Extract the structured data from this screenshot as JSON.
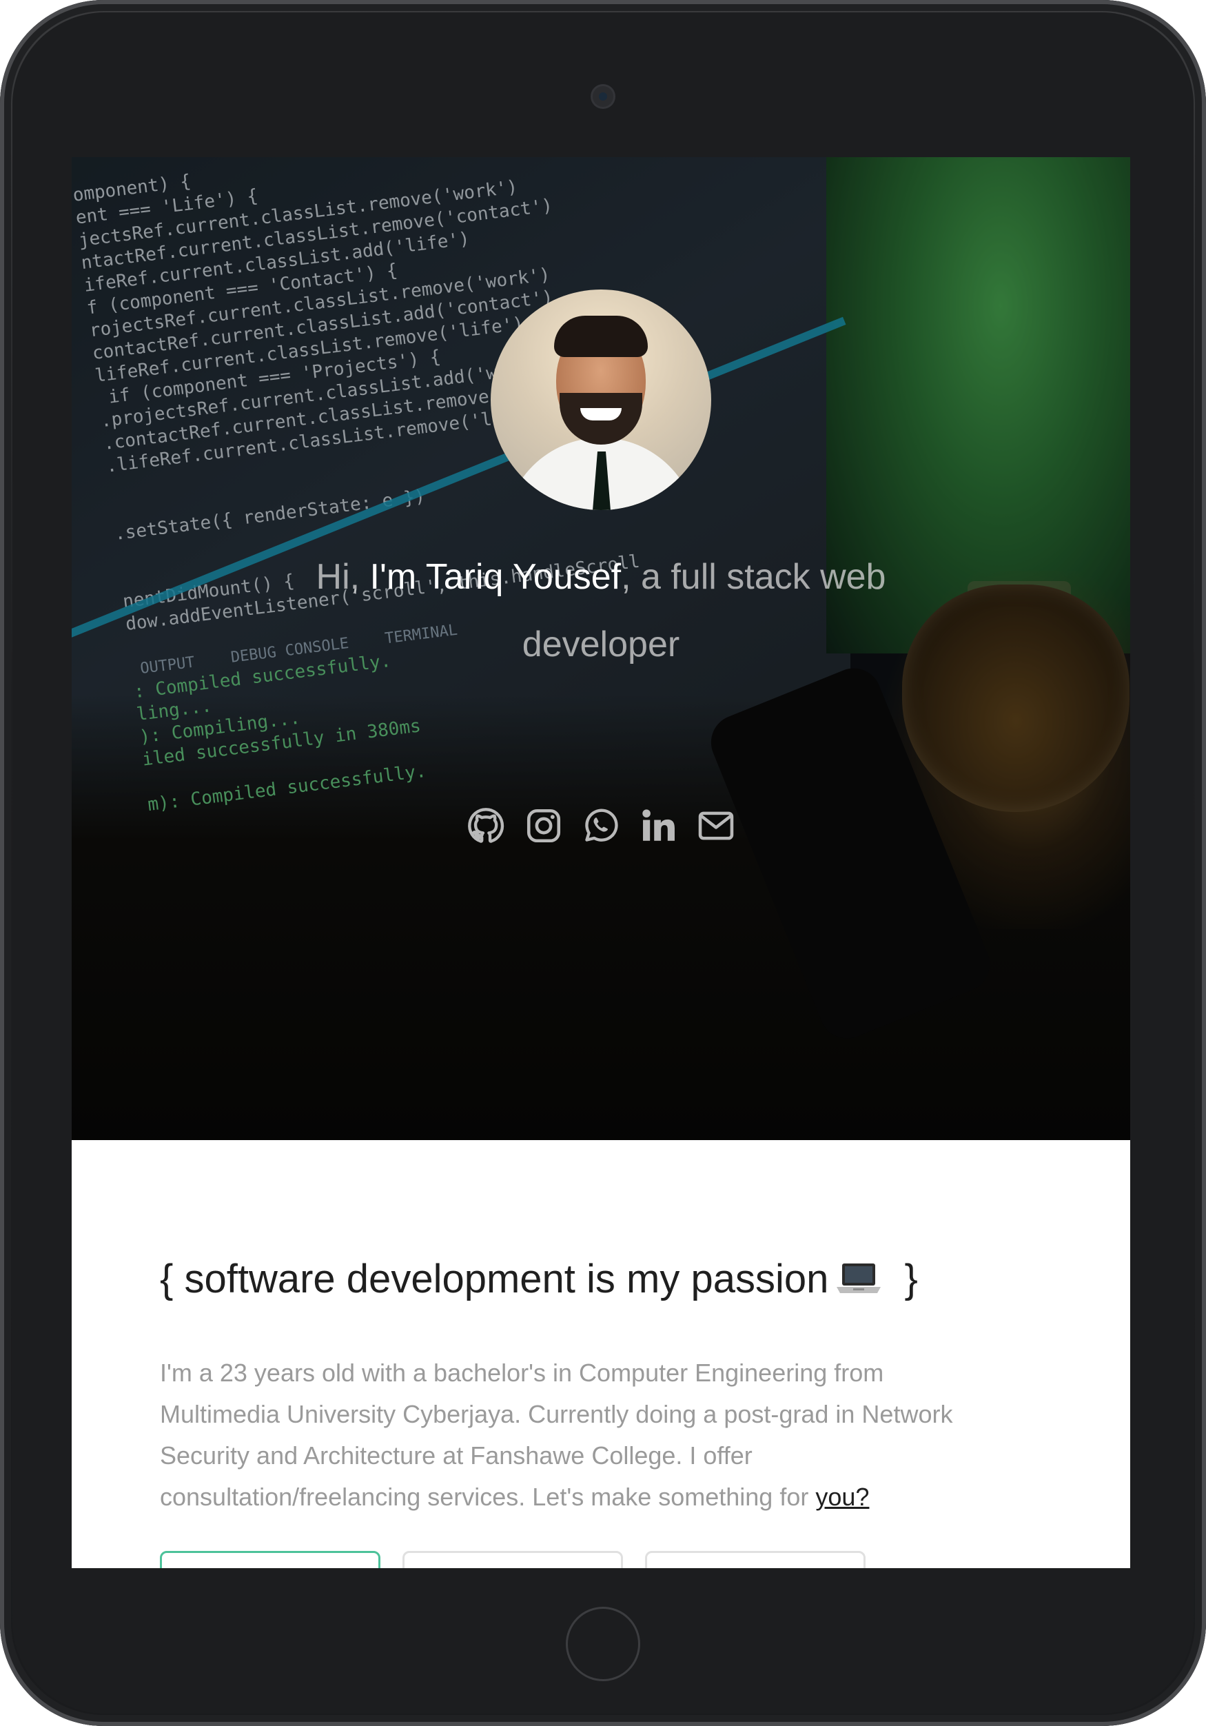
{
  "hero": {
    "greeting_prefix": "Hi, ",
    "name": "I'm Tariq Yousef",
    "greeting_suffix": ", a full stack web developer",
    "socials": [
      {
        "icon": "github-icon"
      },
      {
        "icon": "instagram-icon"
      },
      {
        "icon": "whatsapp-icon"
      },
      {
        "icon": "linkedin-icon"
      },
      {
        "icon": "mail-icon"
      }
    ],
    "code_lines": [
      "omponent) {",
      "ent === 'Life') {",
      "jectsRef.current.classList.remove('work')",
      "ntactRef.current.classList.remove('contact')",
      "ifeRef.current.classList.add('life')",
      "f (component === 'Contact') {",
      "rojectsRef.current.classList.remove('work')",
      "contactRef.current.classList.add('contact')",
      "lifeRef.current.classList.remove('life')",
      " if (component === 'Projects') {",
      ".projectsRef.current.classList.add('work')",
      ".contactRef.current.classList.remove('contact')",
      ".lifeRef.current.classList.remove('life')",
      "",
      "",
      ".setState({ renderState: e })",
      "",
      "",
      "nentDidMount() {",
      "dow.addEventListener('scroll', this.handleScroll",
      "",
      " OUTPUT    DEBUG CONSOLE    TERMINAL",
      ": Compiled successfully.",
      "ling...",
      "): Compiling...",
      "iled successfully in 380ms",
      "",
      "m): Compiled successfully."
    ]
  },
  "about": {
    "title_open": "{ software development is my passion",
    "title_close": " }",
    "text": "I'm a 23 years old with a bachelor's in Computer Engineering from Multimedia University Cyberjaya. Currently doing a post-grad in Network Security and Architecture at Fanshawe College. I offer consultation/freelancing services. Let's make something for ",
    "link": "you?"
  },
  "colors": {
    "accent": "#4cc29a",
    "muted_text": "#9a9a9a",
    "heading_text": "#1f1f1f"
  }
}
